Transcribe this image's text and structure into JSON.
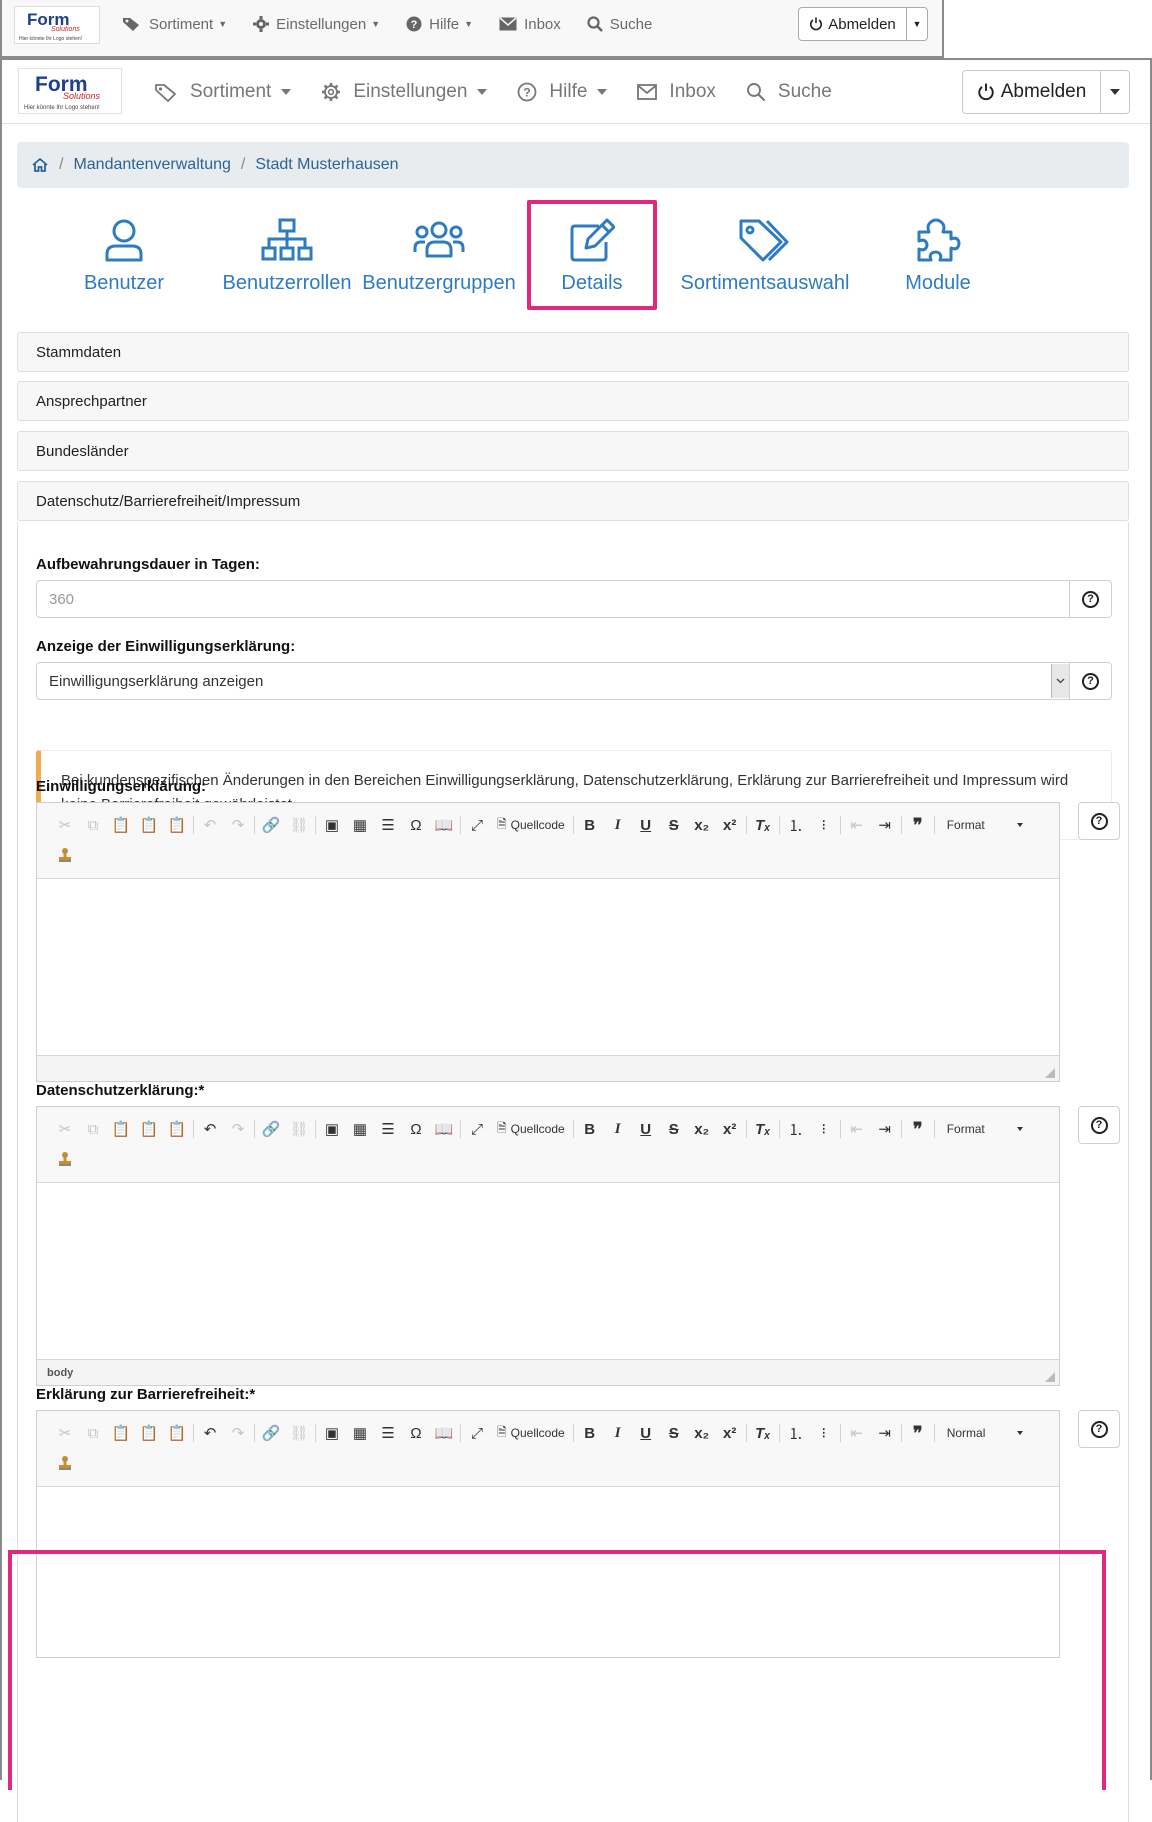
{
  "old_toolbar": {
    "logo_text": "Form",
    "logo_sub": "Solutions",
    "logo_tagline": "Hier könnte Ihr Logo stehen!",
    "nav": [
      {
        "label": "Sortiment",
        "icon": "tag-icon"
      },
      {
        "label": "Einstellungen",
        "icon": "gear-icon"
      },
      {
        "label": "Hilfe",
        "icon": "help-icon"
      },
      {
        "label": "Inbox",
        "icon": "envelope-icon"
      },
      {
        "label": "Suche",
        "icon": "search-icon"
      }
    ],
    "logout_label": "Abmelden"
  },
  "toolbar": {
    "logo_text": "Form",
    "logo_sub": "Solutions",
    "logo_tagline": "Hier könnte Ihr Logo stehen!",
    "nav": [
      {
        "label": "Sortiment",
        "icon": "tag-icon"
      },
      {
        "label": "Einstellungen",
        "icon": "gear-icon"
      },
      {
        "label": "Hilfe",
        "icon": "help-icon"
      },
      {
        "label": "Inbox",
        "icon": "envelope-icon"
      },
      {
        "label": "Suche",
        "icon": "search-icon"
      }
    ],
    "logout_label": "Abmelden"
  },
  "breadcrumb": {
    "items": [
      "Mandantenverwaltung",
      "Stadt Musterhausen"
    ],
    "separator": "/"
  },
  "tiles": [
    {
      "label": "Benutzer",
      "icon": "user-icon"
    },
    {
      "label": "Benutzerrollen",
      "icon": "sitemap-icon"
    },
    {
      "label": "Benutzergruppen",
      "icon": "users-icon"
    },
    {
      "label": "Details",
      "icon": "edit-icon",
      "highlighted": true
    },
    {
      "label": "Sortimentsauswahl",
      "icon": "tags-icon"
    },
    {
      "label": "Module",
      "icon": "puzzle-icon"
    }
  ],
  "accordion": [
    "Stammdaten",
    "Ansprechpartner",
    "Bundesländer",
    "Datenschutz/Barrierefreiheit/Impressum"
  ],
  "form": {
    "retention_label": "Aufbewahrungsdauer in Tagen:",
    "retention_placeholder": "360",
    "consent_display_label": "Anzeige der Einwilligungserklärung:",
    "consent_display_value": "Einwilligungserklärung anzeigen",
    "warning_text": "Bei kundenspezifischen Änderungen in den Bereichen Einwilligungserklärung, Datenschutzerklärung, Erklärung zur Barrierefreiheit und Impressum wird keine Barrierefreiheit gewährleistet.",
    "editors": [
      {
        "label": "Einwilligungserklärung:",
        "format": "Format",
        "status": ""
      },
      {
        "label": "Datenschutzerklärung:*",
        "format": "Format",
        "status": "body"
      },
      {
        "label": "Erklärung zur Barrierefreiheit:*",
        "format": "Normal",
        "status": ""
      }
    ],
    "source_label": "Quellcode",
    "help_glyph": "?"
  },
  "colors": {
    "accent": "#2e7bc0",
    "highlight": "#e0287e",
    "warning": "#f0ad4e"
  }
}
